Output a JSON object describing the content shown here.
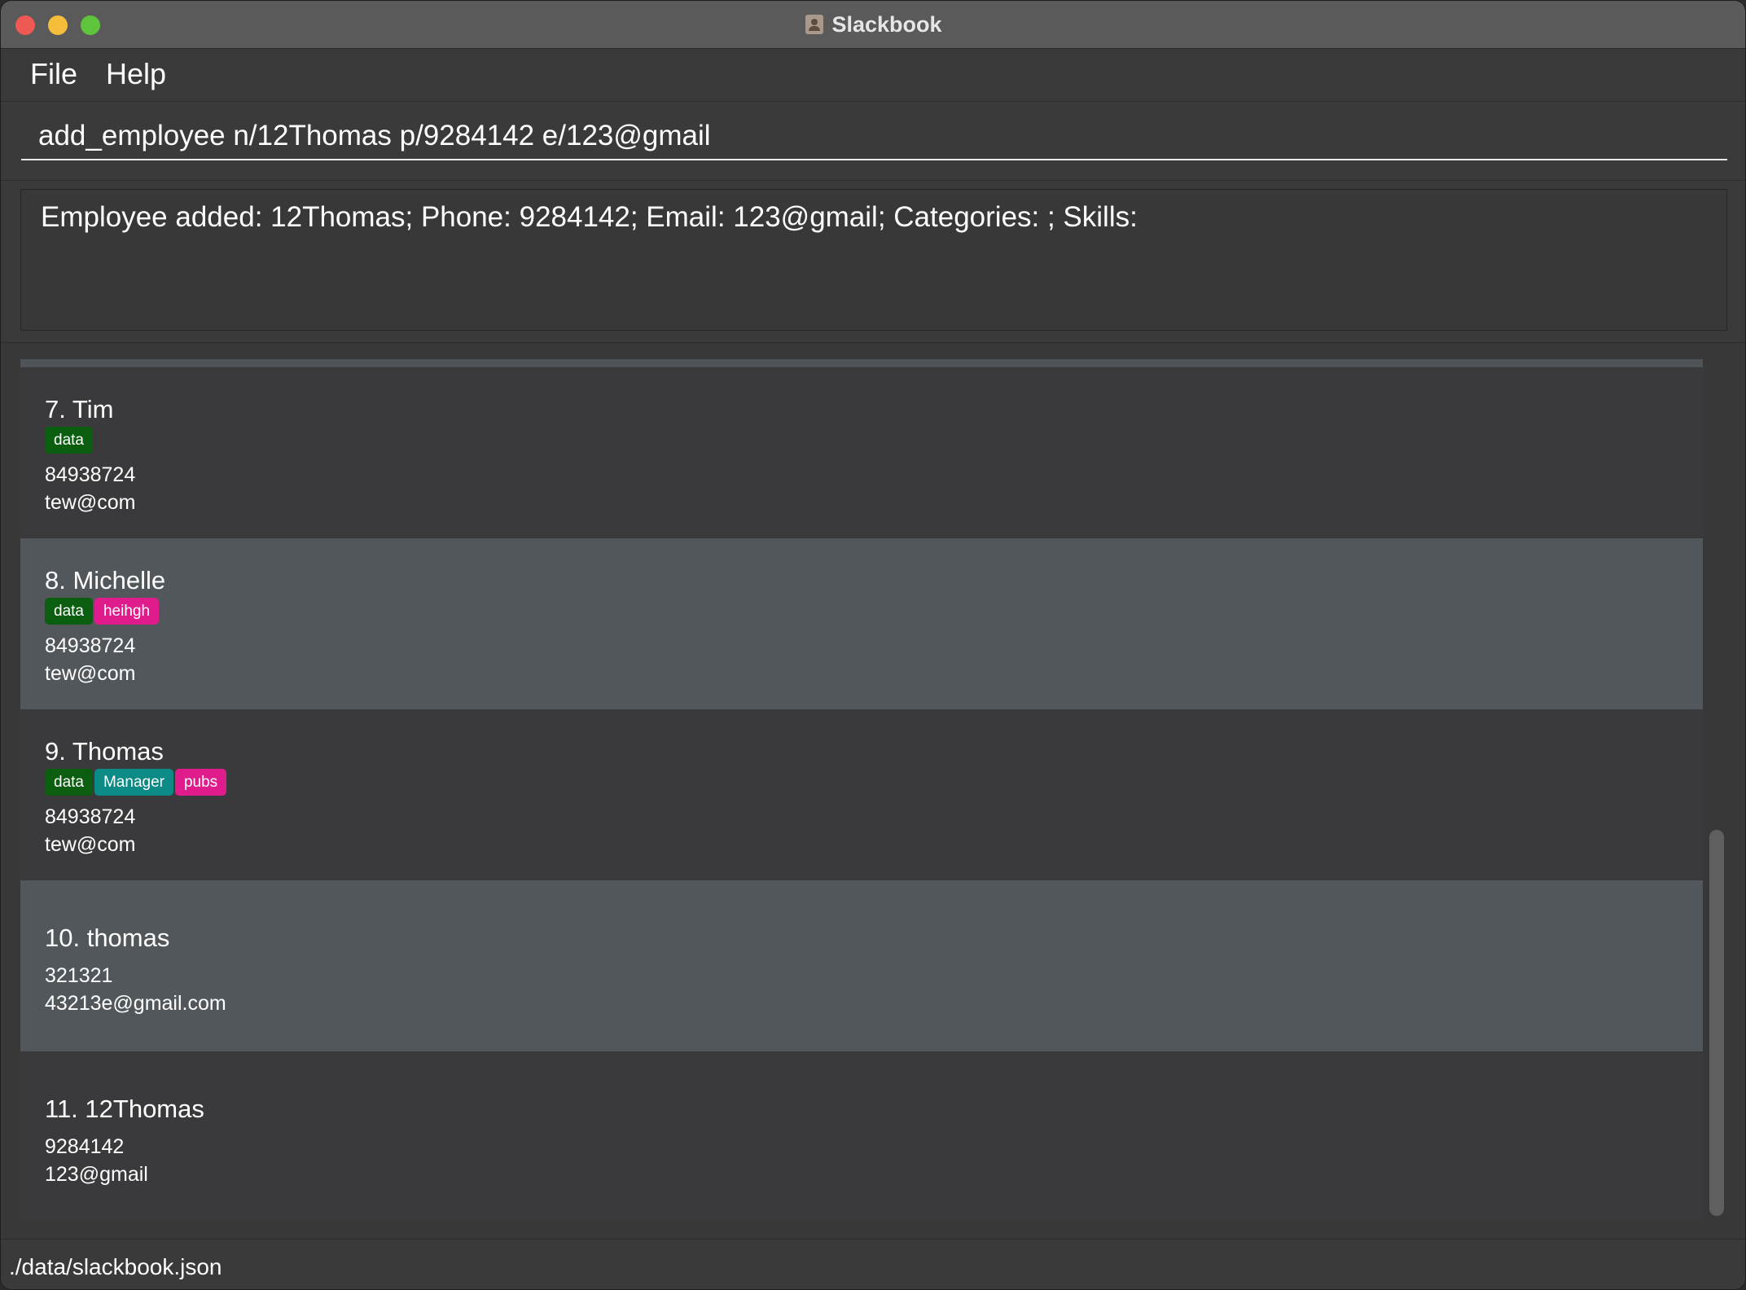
{
  "window": {
    "title": "Slackbook",
    "app_icon": "contacts-book-icon"
  },
  "menu": {
    "file_label": "File",
    "help_label": "Help"
  },
  "command": {
    "value": "add_employee n/12Thomas p/9284142 e/123@gmail"
  },
  "result": {
    "text": "Employee added: 12Thomas; Phone: 9284142; Email: 123@gmail; Categories: ; Skills:"
  },
  "colors": {
    "tag_data": "#0b5e0f",
    "tag_manager": "#0b8a86",
    "tag_pink": "#e01c8c",
    "card_dark": "#3a3a3c",
    "card_light": "#51575b"
  },
  "employees": [
    {
      "name": "7. Tim",
      "tags": [
        {
          "label": "data",
          "color": "#0b5e0f"
        }
      ],
      "phone": "84938724",
      "email": "tew@com"
    },
    {
      "name": "8. Michelle",
      "tags": [
        {
          "label": "data",
          "color": "#0b5e0f"
        },
        {
          "label": "heihgh",
          "color": "#e01c8c"
        }
      ],
      "phone": "84938724",
      "email": "tew@com"
    },
    {
      "name": "9. Thomas",
      "tags": [
        {
          "label": "data",
          "color": "#0b5e0f"
        },
        {
          "label": "Manager",
          "color": "#0b8a86"
        },
        {
          "label": "pubs",
          "color": "#e01c8c"
        }
      ],
      "phone": "84938724",
      "email": "tew@com"
    },
    {
      "name": "10. thomas",
      "tags": [],
      "phone": "321321",
      "email": "43213e@gmail.com"
    },
    {
      "name": "11. 12Thomas",
      "tags": [],
      "phone": "9284142",
      "email": "123@gmail"
    }
  ],
  "status": {
    "file_path": "./data/slackbook.json"
  }
}
